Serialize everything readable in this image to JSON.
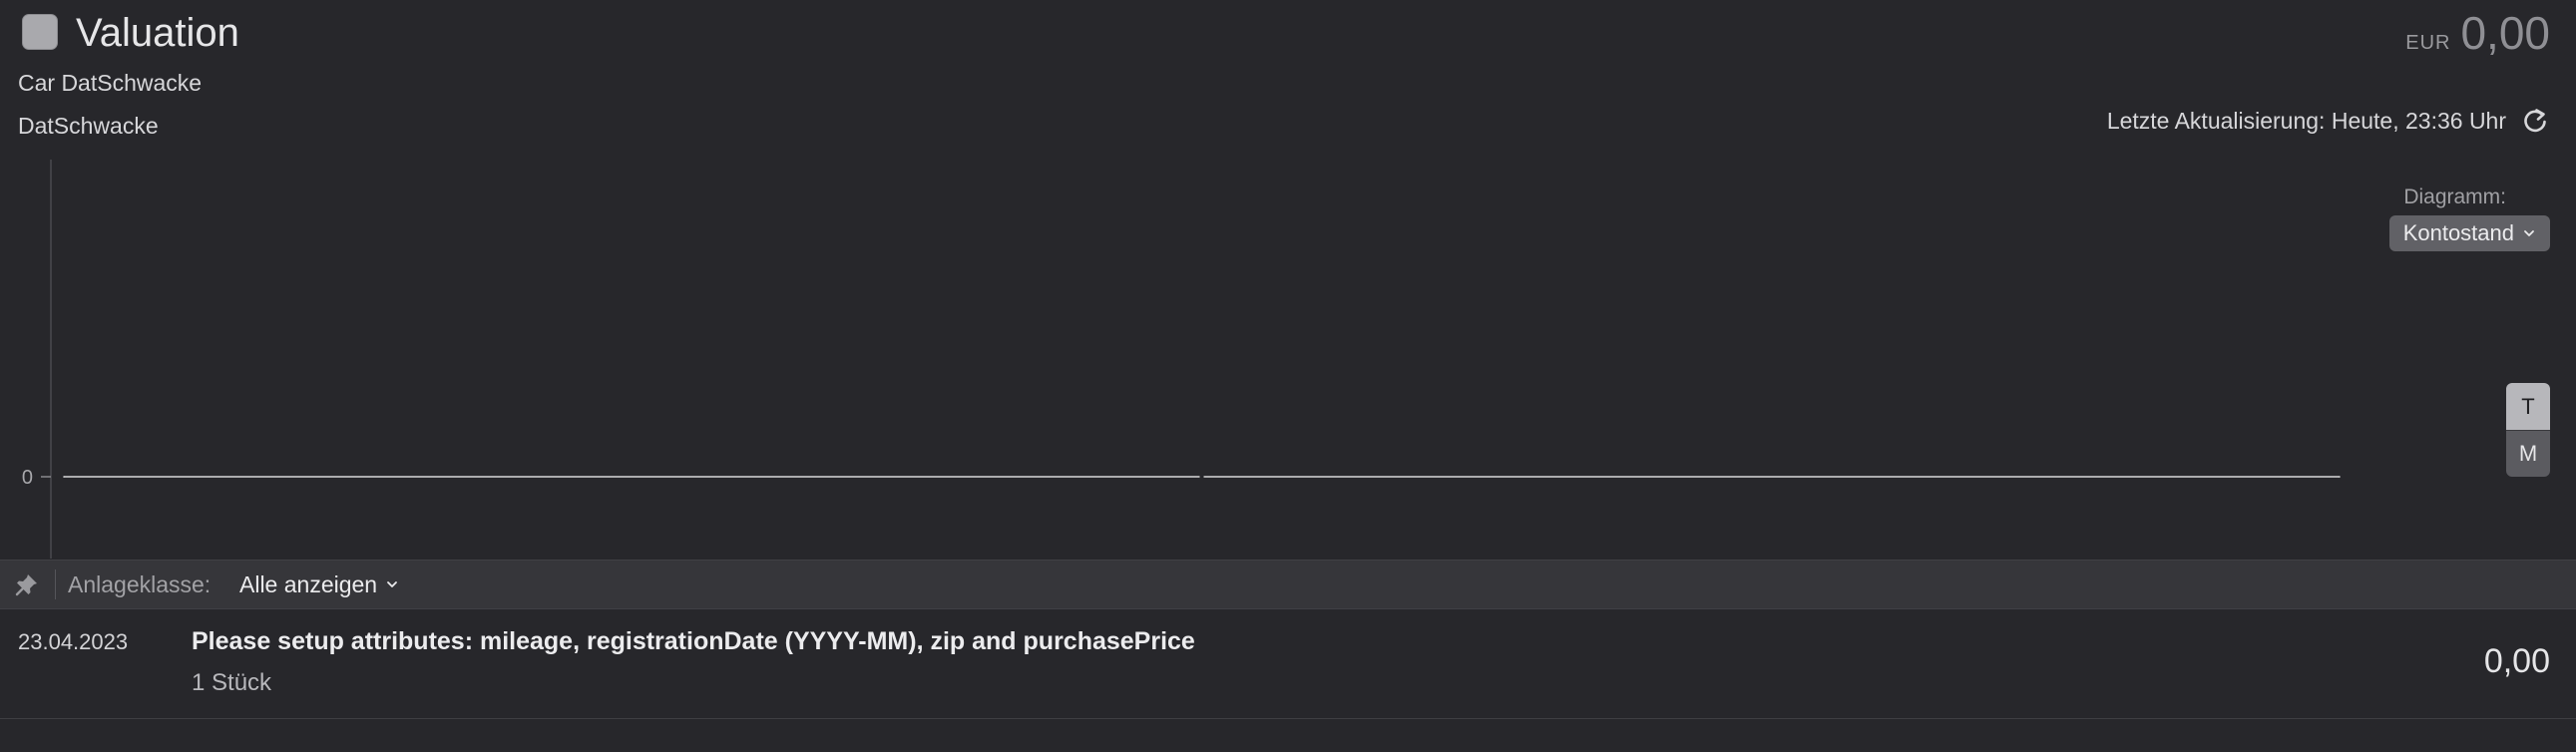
{
  "header": {
    "title": "Valuation",
    "subtitle_line1": "Car DatSchwacke",
    "subtitle_line2": "DatSchwacke",
    "currency": "EUR",
    "balance": "0,00",
    "last_update": "Letzte Aktualisierung: Heute, 23:36 Uhr"
  },
  "diagram": {
    "label": "Diagramm:",
    "selected": "Kontostand"
  },
  "period_toggle": {
    "options": [
      "T",
      "M"
    ],
    "active": "T"
  },
  "filter": {
    "label": "Anlageklasse:",
    "selected": "Alle anzeigen"
  },
  "transactions": [
    {
      "date": "23.04.2023",
      "title": "Please setup attributes: mileage, registrationDate (YYYY-MM), zip and purchasePrice",
      "quantity": "1 Stück",
      "amount": "0,00"
    }
  ],
  "chart_data": {
    "type": "line",
    "y_tick_labels": [
      "0"
    ],
    "series": [
      {
        "values": [
          0,
          0
        ]
      }
    ],
    "grid": false,
    "colors": {
      "line": "#d8d8da",
      "axis": "#4a4a4f"
    }
  },
  "colors": {
    "background": "#27272b",
    "filter_bar": "#36363a",
    "select_bg": "#616166"
  }
}
